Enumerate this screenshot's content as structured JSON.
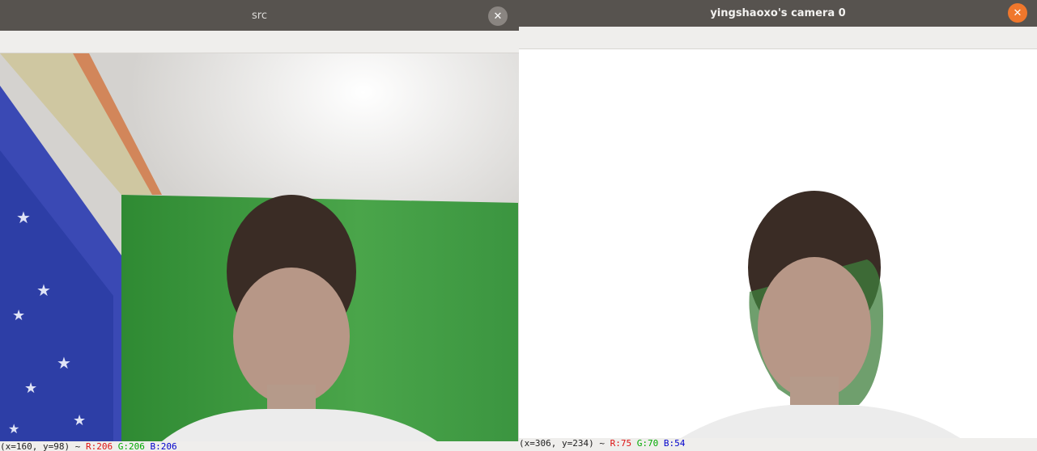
{
  "windows": {
    "src": {
      "title": "src",
      "close_icon": "close-icon",
      "status": {
        "coords": "(x=160, y=98) ~",
        "r": "R:206",
        "g": "G:206",
        "b": "B:206"
      }
    },
    "camera": {
      "title": "yingshaoxo's camera 0",
      "close_icon": "close-icon",
      "status": {
        "coords": "(x=306, y=234) ~ ",
        "r": "R:75",
        "g": "G:70",
        "b": "B:54"
      }
    }
  },
  "colors": {
    "titlebar": "#57534f",
    "close_active": "#f0772c",
    "close_inactive": "#8a8581",
    "green_screen": "#3f9a3d"
  }
}
